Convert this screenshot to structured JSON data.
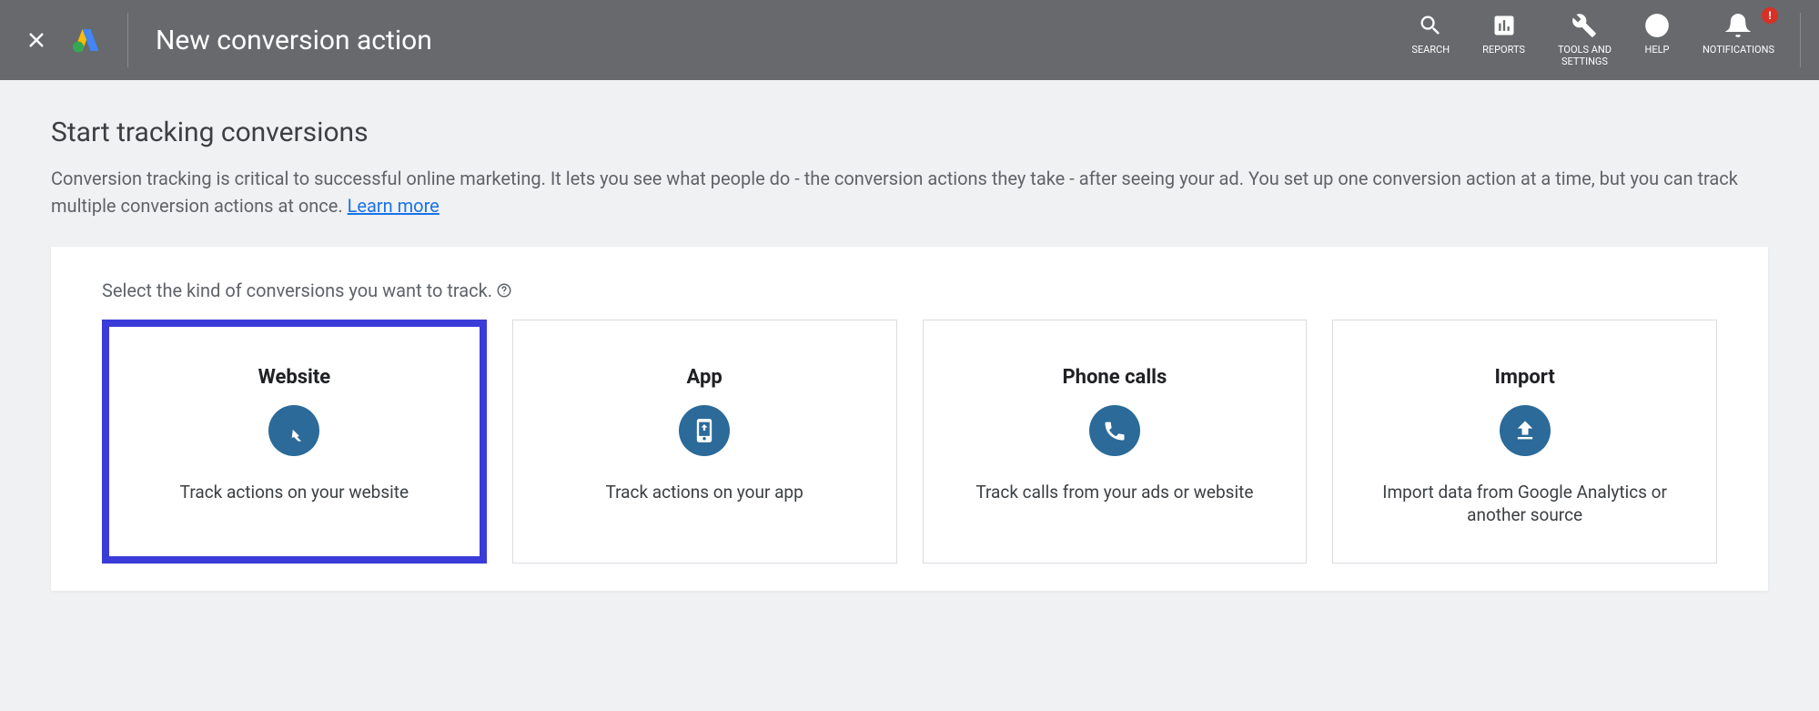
{
  "header": {
    "title": "New conversion action",
    "nav": [
      {
        "label": "SEARCH",
        "icon": "search-icon"
      },
      {
        "label": "REPORTS",
        "icon": "reports-icon"
      },
      {
        "label": "TOOLS AND\nSETTINGS",
        "icon": "tools-icon"
      },
      {
        "label": "HELP",
        "icon": "help-icon"
      },
      {
        "label": "NOTIFICATIONS",
        "icon": "notifications-icon",
        "badge": "!"
      }
    ]
  },
  "main": {
    "heading": "Start tracking conversions",
    "description": "Conversion tracking is critical to successful online marketing. It lets you see what people do - the conversion actions they take - after seeing your ad. You set up one conversion action at a time, but you can track multiple conversion actions at once.  ",
    "learn_more": "Learn more"
  },
  "card": {
    "prompt": "Select the kind of conversions you want to track.",
    "options": [
      {
        "title": "Website",
        "desc": "Track actions on your website",
        "icon": "cursor-click-icon",
        "selected": true
      },
      {
        "title": "App",
        "desc": "Track actions on your app",
        "icon": "phone-icon",
        "selected": false
      },
      {
        "title": "Phone calls",
        "desc": "Track calls from your ads or website",
        "icon": "call-icon",
        "selected": false
      },
      {
        "title": "Import",
        "desc": "Import data from Google Analytics or another source",
        "icon": "upload-icon",
        "selected": false
      }
    ]
  }
}
